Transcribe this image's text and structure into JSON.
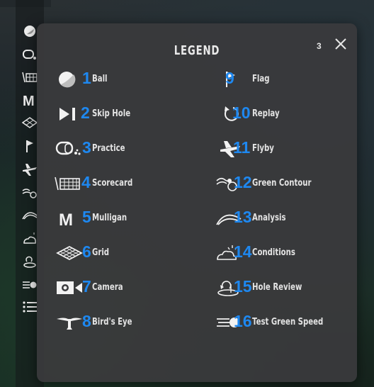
{
  "modal": {
    "title": "LEGEND",
    "corner_number": "3",
    "close_icon": "close-icon"
  },
  "legend": {
    "left": [
      {
        "num": "1",
        "label": "Ball",
        "icon": "ball-icon"
      },
      {
        "num": "2",
        "label": "Skip Hole",
        "icon": "skip-hole-icon"
      },
      {
        "num": "3",
        "label": "Practice",
        "icon": "practice-icon"
      },
      {
        "num": "4",
        "label": "Scorecard",
        "icon": "scorecard-icon"
      },
      {
        "num": "5",
        "label": "Mulligan",
        "icon": "mulligan-icon"
      },
      {
        "num": "6",
        "label": "Grid",
        "icon": "grid-icon"
      },
      {
        "num": "7",
        "label": "Camera",
        "icon": "camera-icon"
      },
      {
        "num": "8",
        "label": "Bird's Eye",
        "icon": "birds-eye-icon"
      }
    ],
    "right": [
      {
        "num": "9",
        "label": "Flag",
        "icon": "flag-icon"
      },
      {
        "num": "10",
        "label": "Replay",
        "icon": "replay-icon"
      },
      {
        "num": "11",
        "label": "Flyby",
        "icon": "flyby-icon"
      },
      {
        "num": "12",
        "label": "Green Contour",
        "icon": "green-contour-icon"
      },
      {
        "num": "13",
        "label": "Analysis",
        "icon": "analysis-icon"
      },
      {
        "num": "14",
        "label": "Conditions",
        "icon": "conditions-icon"
      },
      {
        "num": "15",
        "label": "Hole Review",
        "icon": "hole-review-icon"
      },
      {
        "num": "16",
        "label": "Test Green Speed",
        "icon": "test-green-speed-icon"
      }
    ]
  },
  "toolbar": {
    "items": [
      "ball-icon",
      "practice-icon",
      "scorecard-icon",
      "mulligan-icon",
      "grid-icon",
      "flag-icon",
      "flyby-icon",
      "green-contour-icon",
      "analysis-icon",
      "conditions-icon",
      "hole-review-icon",
      "test-green-speed-icon",
      "list-icon"
    ],
    "mulligan_letter": "M"
  },
  "colors": {
    "number": "#1e88f0",
    "label": "#e3e3e3",
    "modal_bg": "#3a3a3c"
  }
}
